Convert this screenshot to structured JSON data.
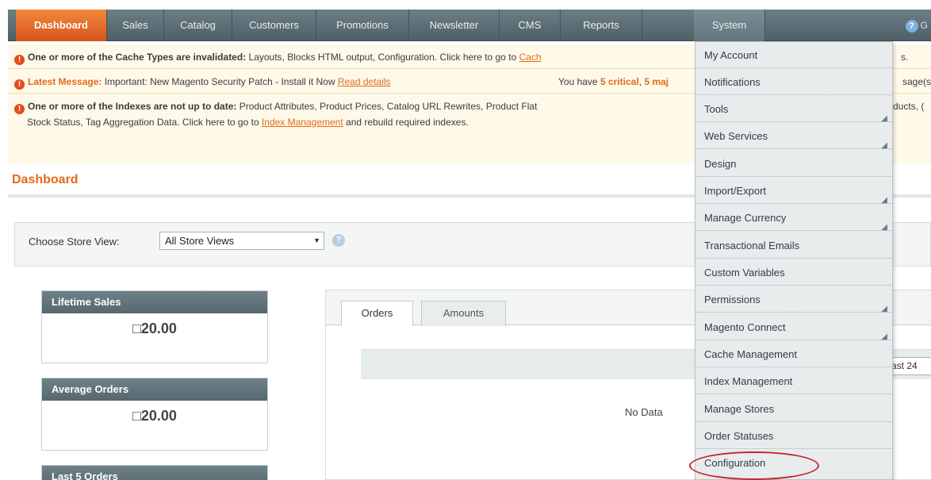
{
  "nav": {
    "items": [
      {
        "label": "Dashboard"
      },
      {
        "label": "Sales"
      },
      {
        "label": "Catalog"
      },
      {
        "label": "Customers"
      },
      {
        "label": "Promotions"
      },
      {
        "label": "Newsletter"
      },
      {
        "label": "CMS"
      },
      {
        "label": "Reports"
      },
      {
        "label": "System"
      }
    ],
    "help_icon": "question-circle-icon",
    "help_label": "G",
    "active_color": "#e46b22"
  },
  "messages": {
    "cache": {
      "bold": "One or more of the Cache Types are invalidated:",
      "text": " Layouts, Blocks HTML output, Configuration. Click here to go to ",
      "link": "Cach",
      "tail": "s."
    },
    "latest": {
      "bold": "Latest Message:",
      "text": " Important: New Magento Security Patch - Install it Now ",
      "link": "Read details",
      "count_text": "You have ",
      "critical": "5 critical",
      "critical_sep": ", ",
      "major": "5 maj",
      "tail": "sage(s)."
    },
    "index": {
      "bold": "One or more of the Indexes are not up to date:",
      "text": " Product Attributes, Product Prices, Catalog URL Rewrites, Product Flat",
      "tail": "ducts, (",
      "line2_text": "Stock Status, Tag Aggregation Data. Click here to go to ",
      "line2_link": "Index Management",
      "line2_tail": " and rebuild required indexes."
    }
  },
  "page": {
    "title": "Dashboard"
  },
  "store_view": {
    "label": "Choose Store View:",
    "selected": "All Store Views"
  },
  "panels": {
    "lifetime": {
      "title": "Lifetime Sales",
      "value": "□20.00"
    },
    "average": {
      "title": "Average Orders",
      "value": "□20.00"
    },
    "last5": {
      "title": "Last 5 Orders"
    }
  },
  "tabs": {
    "orders": "Orders",
    "amounts": "Amounts"
  },
  "grid": {
    "period_label": "ast 24",
    "no_data": "No Data"
  },
  "system_menu": {
    "items": [
      {
        "label": "My Account",
        "submenu": false
      },
      {
        "label": "Notifications",
        "submenu": false
      },
      {
        "label": "Tools",
        "submenu": true
      },
      {
        "label": "Web Services",
        "submenu": true
      },
      {
        "label": "Design",
        "submenu": false
      },
      {
        "label": "Import/Export",
        "submenu": true
      },
      {
        "label": "Manage Currency",
        "submenu": true
      },
      {
        "label": "Transactional Emails",
        "submenu": false
      },
      {
        "label": "Custom Variables",
        "submenu": false
      },
      {
        "label": "Permissions",
        "submenu": true
      },
      {
        "label": "Magento Connect",
        "submenu": true
      },
      {
        "label": "Cache Management",
        "submenu": false
      },
      {
        "label": "Index Management",
        "submenu": false
      },
      {
        "label": "Manage Stores",
        "submenu": false
      },
      {
        "label": "Order Statuses",
        "submenu": false
      },
      {
        "label": "Configuration",
        "submenu": false
      }
    ],
    "highlight_color": "#c9252b"
  }
}
